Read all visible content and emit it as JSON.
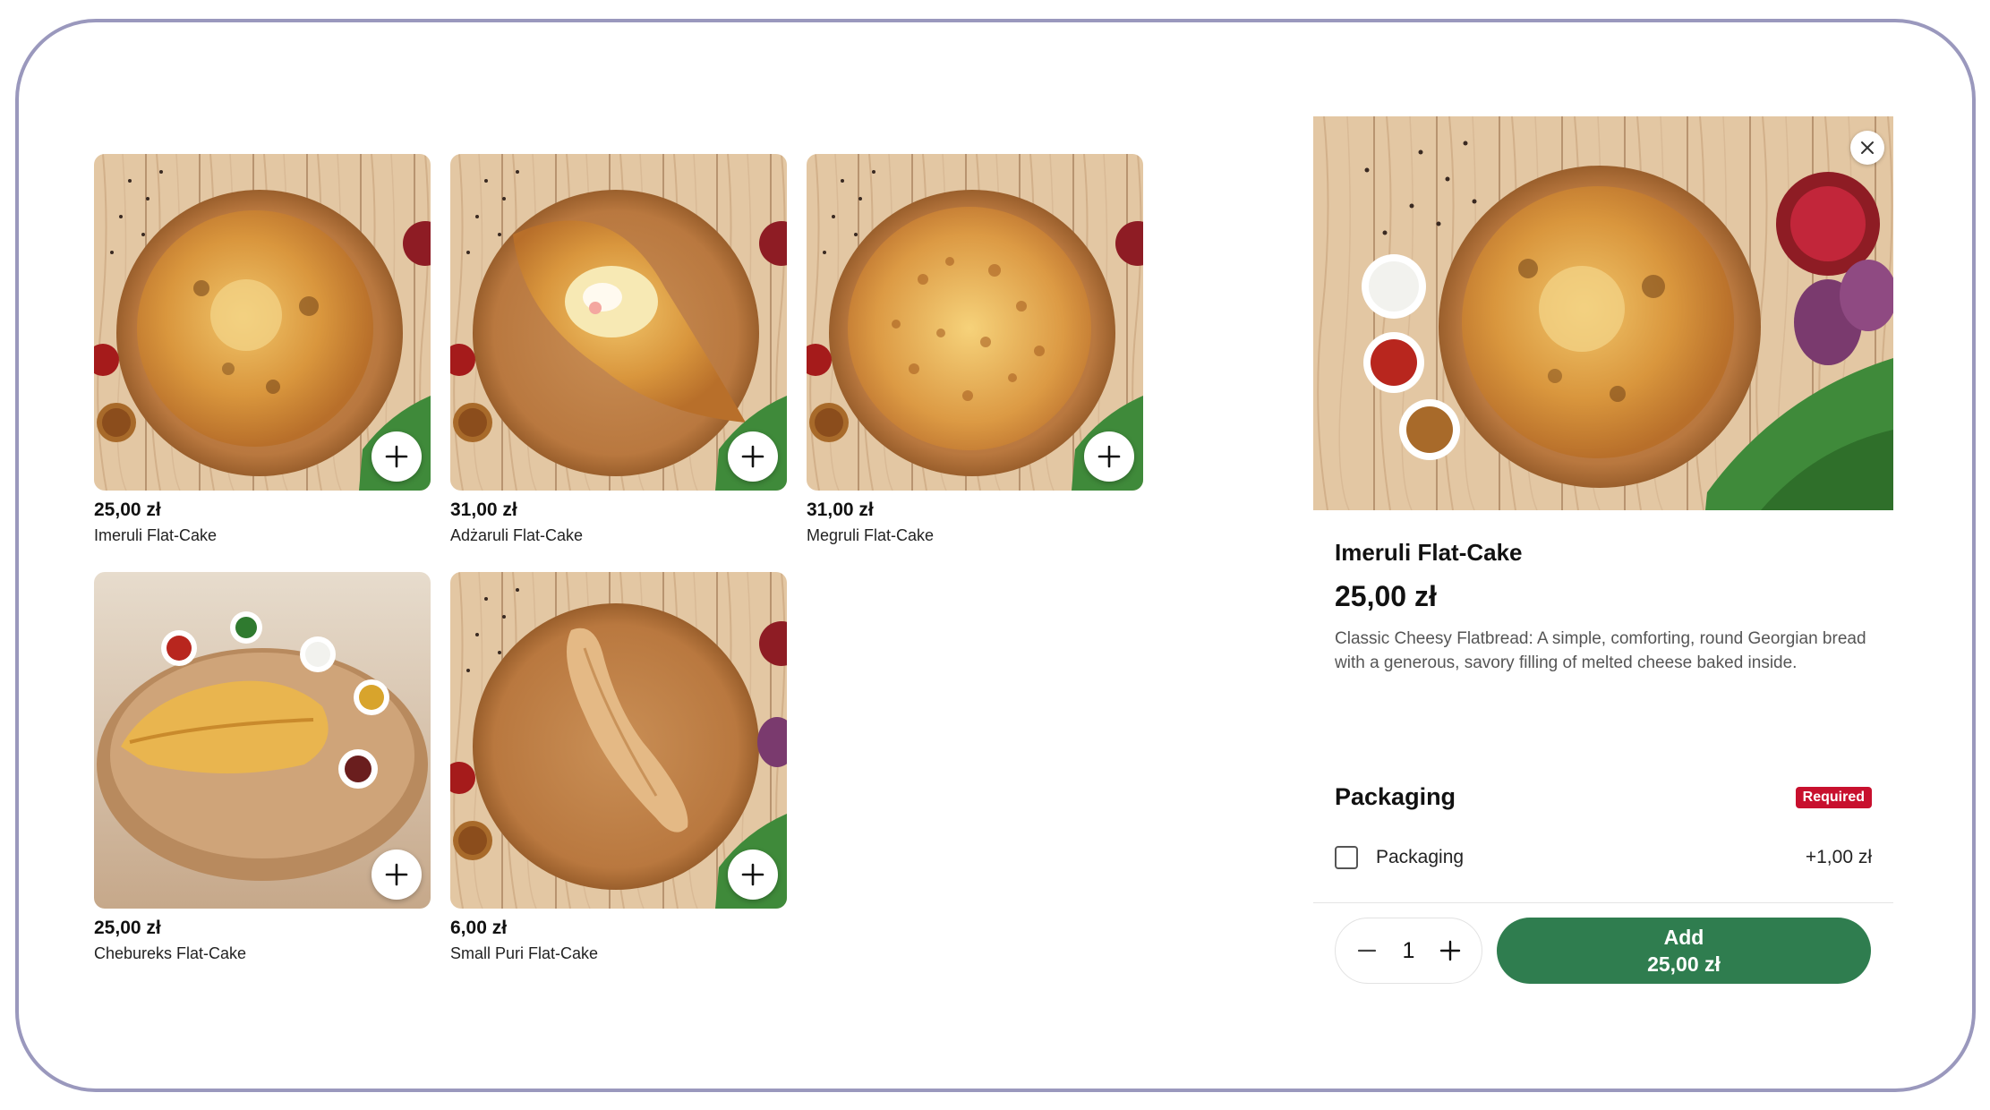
{
  "menu": {
    "items": [
      {
        "price": "25,00 zł",
        "name": "Imeruli Flat-Cake",
        "icon": "plus-icon"
      },
      {
        "price": "31,00 zł",
        "name": "Adżaruli Flat-Cake",
        "icon": "plus-icon"
      },
      {
        "price": "31,00 zł",
        "name": "Megruli Flat-Cake",
        "icon": "plus-icon"
      },
      {
        "price": "25,00 zł",
        "name": "Chebureks Flat-Cake",
        "icon": "plus-icon"
      },
      {
        "price": "6,00 zł",
        "name": "Small Puri Flat-Cake",
        "icon": "plus-icon"
      }
    ]
  },
  "detail": {
    "title": "Imeruli Flat-Cake",
    "price": "25,00 zł",
    "description": "Classic Cheesy Flatbread: A simple, comforting, round Georgian bread with a generous, savory filling of melted cheese baked inside.",
    "close_icon": "close-icon",
    "packaging": {
      "title": "Packaging",
      "badge": "Required",
      "option_label": "Packaging",
      "option_price": "+1,00 zł",
      "checked": false
    },
    "quantity": "1",
    "add_button": {
      "label": "Add",
      "total": "25,00 zł"
    }
  },
  "colors": {
    "accent_green": "#2f7d4f",
    "required_red": "#c8102e",
    "frame_border": "#9a98bd"
  }
}
